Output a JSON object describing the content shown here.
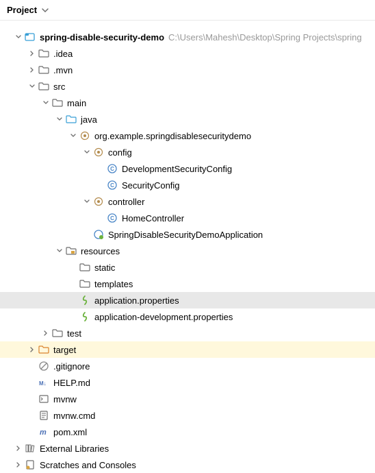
{
  "header": {
    "title": "Project"
  },
  "tree": [
    {
      "depth": 0,
      "arrow": "down",
      "icon": "module",
      "label": "spring-disable-security-demo",
      "bold": true,
      "hint": "C:\\Users\\Mahesh\\Desktop\\Spring Projects\\spring"
    },
    {
      "depth": 1,
      "arrow": "right",
      "icon": "folder",
      "label": ".idea"
    },
    {
      "depth": 1,
      "arrow": "right",
      "icon": "folder",
      "label": ".mvn"
    },
    {
      "depth": 1,
      "arrow": "down",
      "icon": "folder",
      "label": "src"
    },
    {
      "depth": 2,
      "arrow": "down",
      "icon": "folder",
      "label": "main"
    },
    {
      "depth": 3,
      "arrow": "down",
      "icon": "src-folder",
      "label": "java"
    },
    {
      "depth": 4,
      "arrow": "down",
      "icon": "package",
      "label": "org.example.springdisablesecuritydemo"
    },
    {
      "depth": 5,
      "arrow": "down",
      "icon": "package",
      "label": "config"
    },
    {
      "depth": 6,
      "arrow": "none",
      "icon": "class",
      "label": "DevelopmentSecurityConfig"
    },
    {
      "depth": 6,
      "arrow": "none",
      "icon": "class",
      "label": "SecurityConfig"
    },
    {
      "depth": 5,
      "arrow": "down",
      "icon": "package",
      "label": "controller"
    },
    {
      "depth": 6,
      "arrow": "none",
      "icon": "class",
      "label": "HomeController"
    },
    {
      "depth": 5,
      "arrow": "none",
      "icon": "springboot",
      "label": "SpringDisableSecurityDemoApplication"
    },
    {
      "depth": 3,
      "arrow": "down",
      "icon": "res-folder",
      "label": "resources"
    },
    {
      "depth": 4,
      "arrow": "none",
      "icon": "folder",
      "label": "static"
    },
    {
      "depth": 4,
      "arrow": "none",
      "icon": "folder",
      "label": "templates"
    },
    {
      "depth": 4,
      "arrow": "none",
      "icon": "props",
      "label": "application.properties",
      "selected": true
    },
    {
      "depth": 4,
      "arrow": "none",
      "icon": "props",
      "label": "application-development.properties"
    },
    {
      "depth": 2,
      "arrow": "right",
      "icon": "folder",
      "label": "test"
    },
    {
      "depth": 1,
      "arrow": "right",
      "icon": "target-folder",
      "label": "target",
      "highlighted": true
    },
    {
      "depth": 1,
      "arrow": "none",
      "icon": "gitignore",
      "label": ".gitignore"
    },
    {
      "depth": 1,
      "arrow": "none",
      "icon": "markdown",
      "label": "HELP.md"
    },
    {
      "depth": 1,
      "arrow": "none",
      "icon": "shell",
      "label": "mvnw"
    },
    {
      "depth": 1,
      "arrow": "none",
      "icon": "text",
      "label": "mvnw.cmd"
    },
    {
      "depth": 1,
      "arrow": "none",
      "icon": "maven",
      "label": "pom.xml"
    },
    {
      "depth": 0,
      "arrow": "right",
      "icon": "libs",
      "label": "External Libraries"
    },
    {
      "depth": 0,
      "arrow": "right",
      "icon": "scratch",
      "label": "Scratches and Consoles"
    }
  ]
}
